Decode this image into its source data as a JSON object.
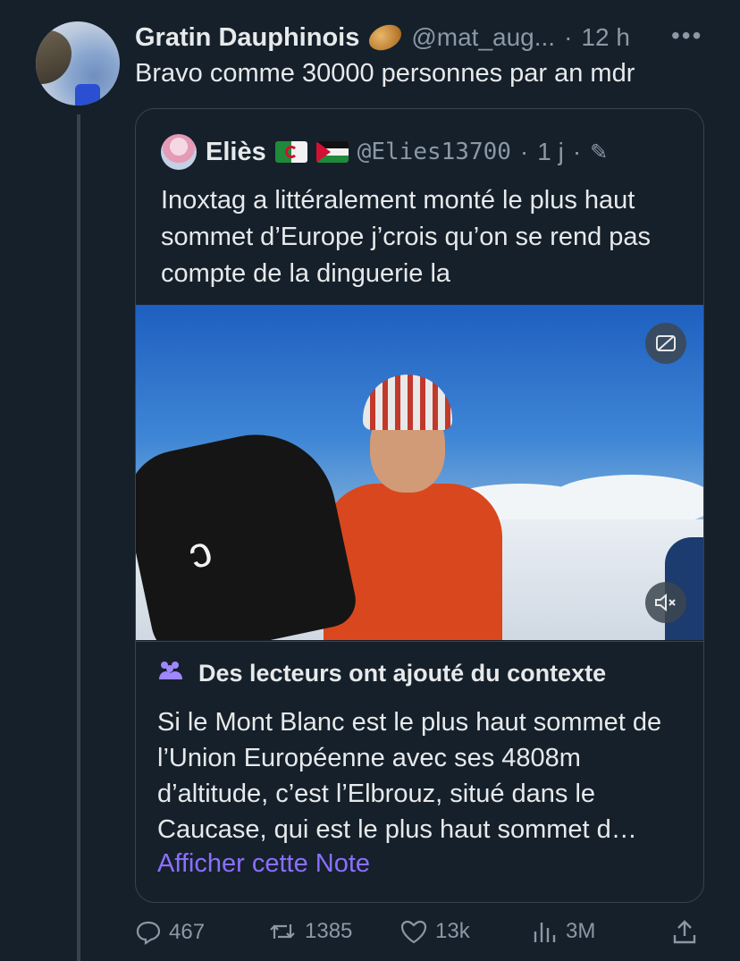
{
  "tweet": {
    "author_name": "Gratin Dauphinois",
    "emoji_icon": "potato-icon",
    "handle": "@mat_aug...",
    "separator": "·",
    "time": "12 h",
    "more_label": "•••",
    "text": "Bravo comme 30000 personnes par an mdr"
  },
  "quote": {
    "author_name": "Eliès",
    "handle": "@Elies13700",
    "separator": "·",
    "time": "1 j",
    "separator2": "·",
    "text": "Inoxtag a littéralement monté le plus haut sommet d’Europe j’crois qu’on se rend pas compte de la dinguerie la",
    "flags": [
      "algeria-flag",
      "palestine-flag"
    ]
  },
  "media": {
    "cc_icon": "captions-off-icon",
    "mute_icon": "mute-icon"
  },
  "context": {
    "title": "Des lecteurs ont ajouté du contexte",
    "text": "Si le Mont Blanc est le plus haut sommet de l’Union Européenne avec ses 4808m d’altitude, c’est l’Elbrouz, situé dans le Caucase, qui est le plus haut sommet d…",
    "link": "Afficher cette Note"
  },
  "actions": {
    "replies": "467",
    "retweets": "1385",
    "likes": "13k",
    "views": "3M"
  },
  "colors": {
    "background": "#15202b",
    "accent_purple": "#8b6fff",
    "muted": "#8b98a5"
  }
}
